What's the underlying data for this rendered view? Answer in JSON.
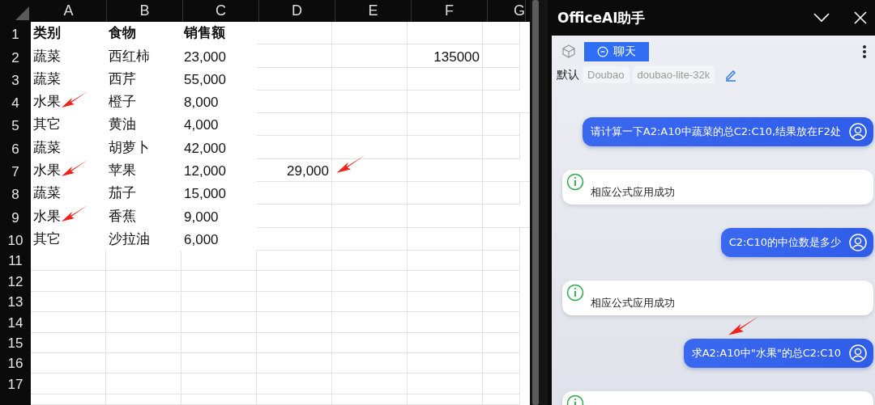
{
  "sheet": {
    "columns": [
      "A",
      "B",
      "C",
      "D",
      "E",
      "F",
      "G"
    ],
    "rows": [
      {
        "number": "1",
        "bold": true,
        "a": "类别",
        "b": "食物",
        "c": "销售额",
        "arrow_a": false,
        "arrow_d": false
      },
      {
        "number": "2",
        "bold": false,
        "a": "蔬菜",
        "b": "西红柿",
        "c": "23,000",
        "f": "135000",
        "arrow_a": false,
        "arrow_d": false
      },
      {
        "number": "3",
        "bold": false,
        "a": "蔬菜",
        "b": "西芹",
        "c": "55,000",
        "arrow_a": false,
        "arrow_d": false
      },
      {
        "number": "4",
        "bold": false,
        "a": "水果",
        "b": "橙子",
        "c": "8,000",
        "arrow_a": true,
        "arrow_d": false
      },
      {
        "number": "5",
        "bold": false,
        "a": "其它",
        "b": "黄油",
        "c": "4,000",
        "arrow_a": false,
        "arrow_d": false
      },
      {
        "number": "6",
        "bold": false,
        "a": "蔬菜",
        "b": "胡萝卜",
        "c": "42,000",
        "arrow_a": false,
        "arrow_d": false
      },
      {
        "number": "7",
        "bold": false,
        "a": "水果",
        "b": "苹果",
        "c": "12,000",
        "d": "29,000",
        "arrow_a": true,
        "arrow_d": true
      },
      {
        "number": "8",
        "bold": false,
        "a": "蔬菜",
        "b": "茄子",
        "c": "15,000",
        "arrow_a": false,
        "arrow_d": false
      },
      {
        "number": "9",
        "bold": false,
        "a": "水果",
        "b": "香蕉",
        "c": "9,000",
        "arrow_a": true,
        "arrow_d": false
      },
      {
        "number": "10",
        "bold": false,
        "a": "其它",
        "b": "沙拉油",
        "c": "6,000",
        "arrow_a": false,
        "arrow_d": false
      },
      {
        "number": "11"
      },
      {
        "number": "12"
      },
      {
        "number": "13"
      },
      {
        "number": "14"
      },
      {
        "number": "15"
      },
      {
        "number": "16"
      },
      {
        "number": "17"
      }
    ]
  },
  "assistant": {
    "title": "OfficeAI助手",
    "tabs": [
      {
        "label": "聊天",
        "selected": true
      }
    ],
    "model_label": "默认",
    "chips": [
      "Doubao",
      "doubao-lite-32k"
    ],
    "messages": [
      {
        "kind": "user",
        "text": "请计算一下A2:A10中蔬菜的总C2:C10,结果放在F2处",
        "arrow": false
      },
      {
        "kind": "bot",
        "text": "相应公式应用成功"
      },
      {
        "kind": "user",
        "text": "C2:C10的中位数是多少",
        "arrow": false
      },
      {
        "kind": "bot",
        "text": "相应公式应用成功"
      },
      {
        "kind": "user",
        "text": "求A2:A10中\"水果\"的总C2:C10",
        "arrow": true
      },
      {
        "kind": "bot"
      }
    ]
  }
}
